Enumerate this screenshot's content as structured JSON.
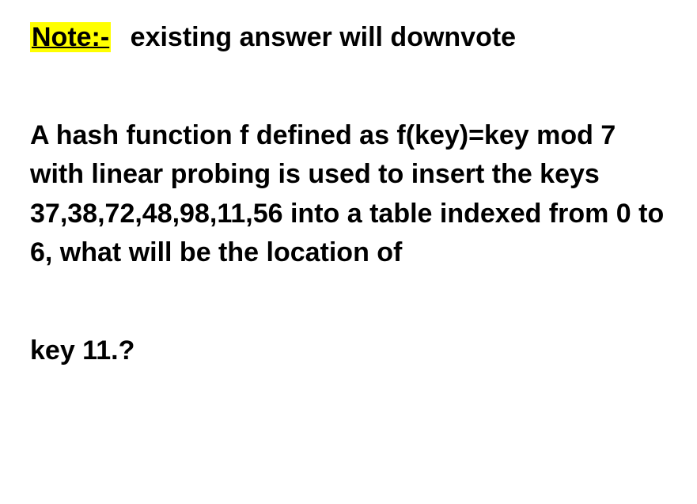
{
  "note": {
    "label": "Note:-",
    "text": "existing answer will downvote"
  },
  "question": {
    "body": "A hash function f defined as f(key)=key mod 7 with linear probing is used to insert the keys 37,38,72,48,98,11,56 into a table indexed from 0 to 6, what will be the location of",
    "tail": "key 11.?"
  }
}
